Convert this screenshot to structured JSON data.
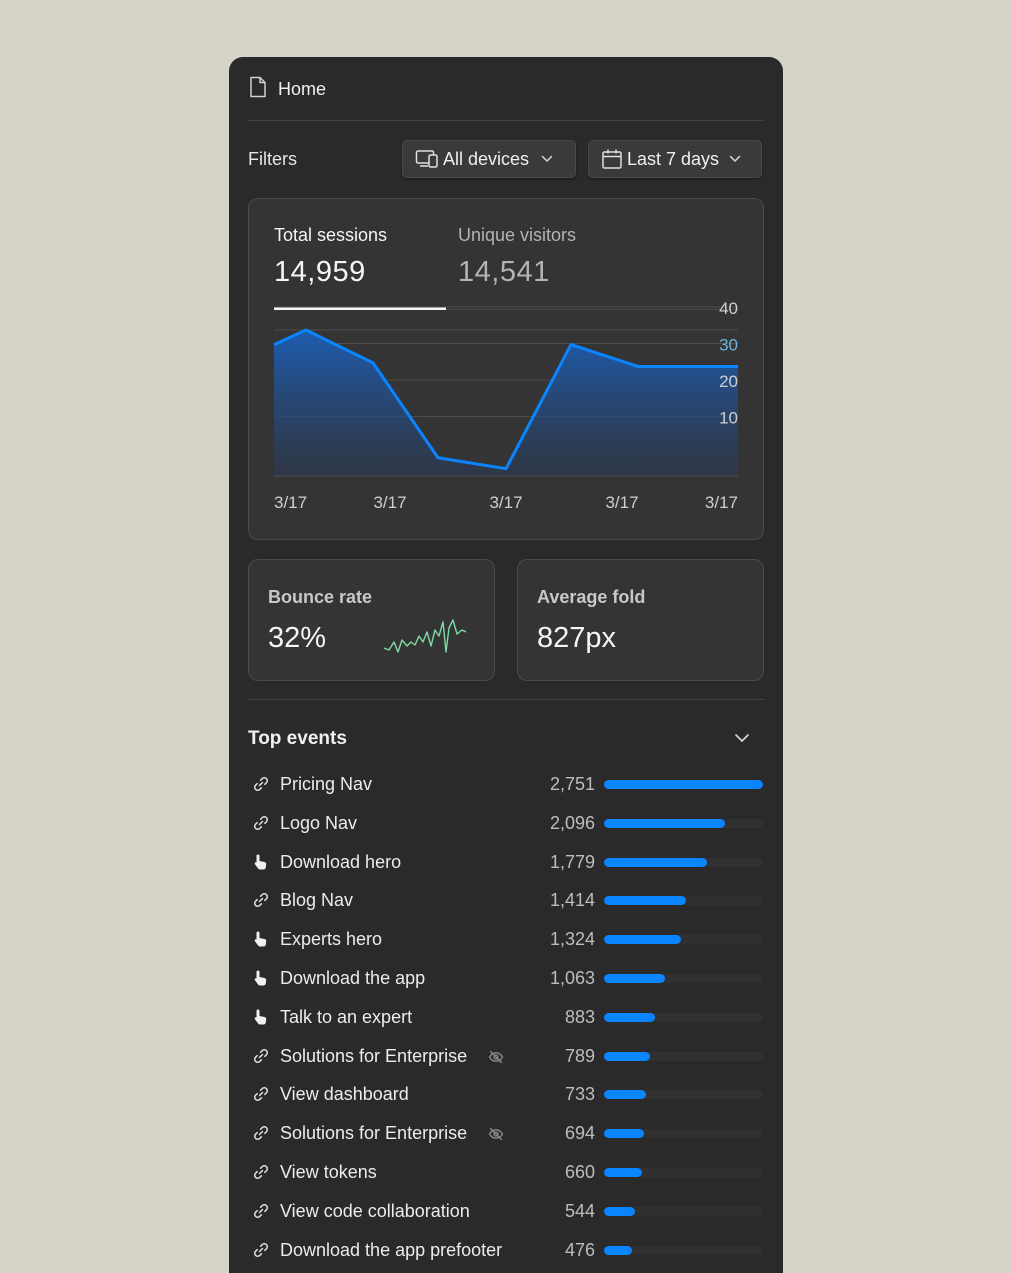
{
  "header": {
    "title": "Home"
  },
  "filters": {
    "label": "Filters",
    "devices": "All devices",
    "range": "Last 7 days"
  },
  "tabs": {
    "sessions": {
      "label": "Total sessions",
      "value": "14,959"
    },
    "visitors": {
      "label": "Unique visitors",
      "value": "14,541"
    }
  },
  "chart_data": {
    "type": "area",
    "title": "",
    "x": [
      "3/17",
      "3/17",
      "3/17",
      "3/17",
      "3/17"
    ],
    "ytick_labels": [
      "40",
      "30",
      "20",
      "10"
    ],
    "yticks": [
      40,
      30,
      20,
      10
    ],
    "ylim": [
      0,
      40
    ],
    "grid": true,
    "series": [
      {
        "values": [
          36,
          40,
          31,
          5,
          2,
          36,
          30,
          30,
          30
        ],
        "color": "#0a84ff"
      }
    ]
  },
  "metrics": {
    "bounce": {
      "label": "Bounce rate",
      "value": "32%",
      "sparkline_color": "#7fd9a3"
    },
    "fold": {
      "label": "Average fold",
      "value": "827px"
    }
  },
  "events": {
    "title": "Top events",
    "max": 2751,
    "items": [
      {
        "name": "Pricing Nav",
        "count": "2,751",
        "value": 2751,
        "icon": "link-icon",
        "hidden": false
      },
      {
        "name": "Logo Nav",
        "count": "2,096",
        "value": 2096,
        "icon": "link-icon",
        "hidden": false
      },
      {
        "name": "Download hero",
        "count": "1,779",
        "value": 1779,
        "icon": "pointer-icon",
        "hidden": false
      },
      {
        "name": "Blog Nav",
        "count": "1,414",
        "value": 1414,
        "icon": "link-icon",
        "hidden": false
      },
      {
        "name": "Experts hero",
        "count": "1,324",
        "value": 1324,
        "icon": "pointer-icon",
        "hidden": false
      },
      {
        "name": "Download the app",
        "count": "1,063",
        "value": 1063,
        "icon": "pointer-icon",
        "hidden": false
      },
      {
        "name": "Talk to an expert",
        "count": "883",
        "value": 883,
        "icon": "pointer-icon",
        "hidden": false
      },
      {
        "name": "Solutions for Enterprise",
        "count": "789",
        "value": 789,
        "icon": "link-icon",
        "hidden": true
      },
      {
        "name": "View dashboard",
        "count": "733",
        "value": 733,
        "icon": "link-icon",
        "hidden": false
      },
      {
        "name": "Solutions for Enterprise",
        "count": "694",
        "value": 694,
        "icon": "link-icon",
        "hidden": true
      },
      {
        "name": "View tokens",
        "count": "660",
        "value": 660,
        "icon": "link-icon",
        "hidden": false
      },
      {
        "name": "View code collaboration",
        "count": "544",
        "value": 544,
        "icon": "link-icon",
        "hidden": false
      },
      {
        "name": "Download the app prefooter",
        "count": "476",
        "value": 476,
        "icon": "link-icon",
        "hidden": false
      }
    ]
  },
  "colors": {
    "accent": "#0a84ff",
    "panel": "#2a2a2a",
    "card": "#343434"
  }
}
